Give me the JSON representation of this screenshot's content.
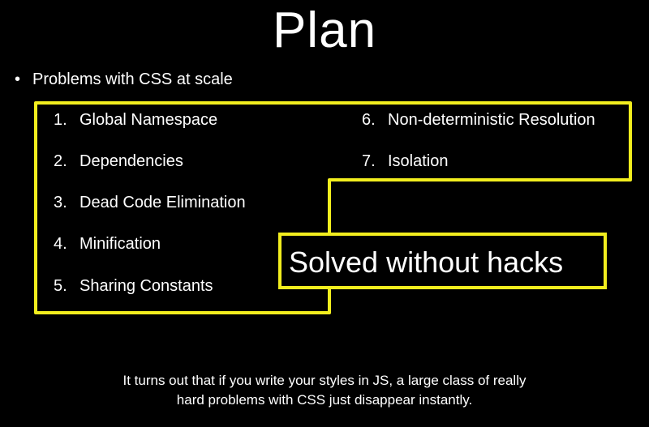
{
  "slide": {
    "title": "Plan",
    "bullet_symbol": "•",
    "bullet": "Problems with CSS at scale",
    "items": [
      {
        "num": "1.",
        "label": "Global Namespace"
      },
      {
        "num": "2.",
        "label": "Dependencies"
      },
      {
        "num": "3.",
        "label": "Dead Code Elimination"
      },
      {
        "num": "4.",
        "label": "Minification"
      },
      {
        "num": "5.",
        "label": "Sharing Constants"
      },
      {
        "num": "6.",
        "label": "Non-deterministic Resolution"
      },
      {
        "num": "7.",
        "label": "Isolation"
      }
    ],
    "callout": "Solved without hacks",
    "footer_line1": "It turns out that if you write your styles in JS, a large class of really",
    "footer_line2": "hard problems with CSS just disappear instantly."
  },
  "colors": {
    "background": "#000000",
    "text": "#ffffff",
    "highlight": "#f2ee1e"
  }
}
